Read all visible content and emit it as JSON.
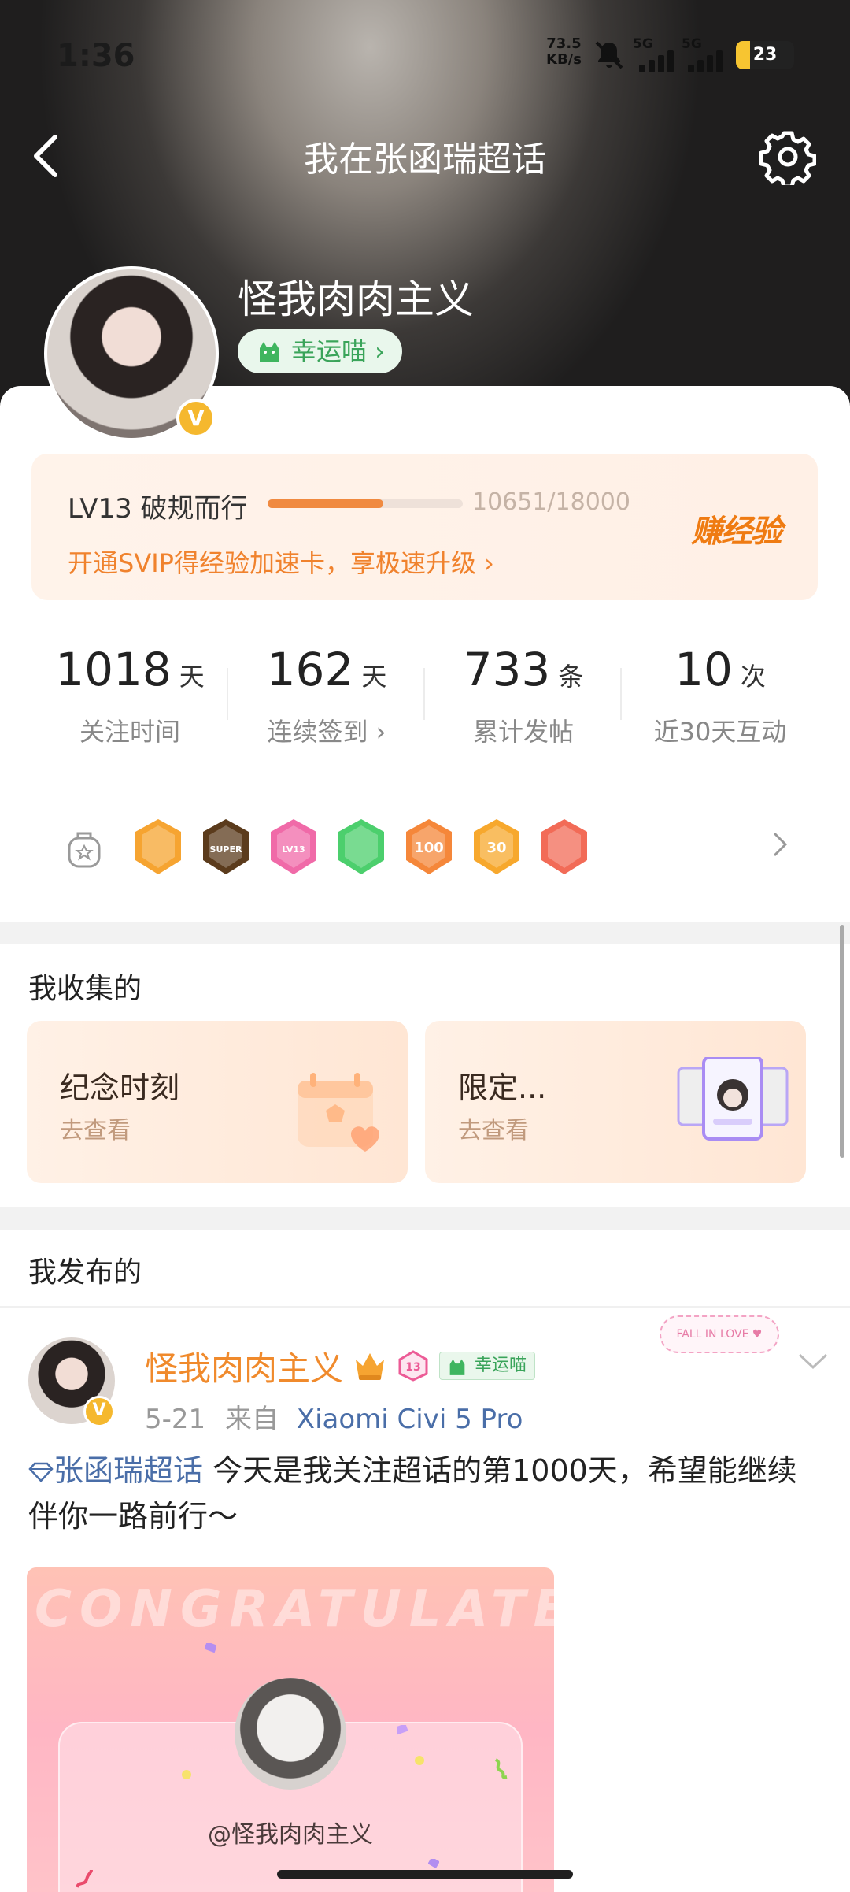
{
  "status_bar": {
    "time": "1:36",
    "net_speed_value": "73.5",
    "net_speed_unit": "KB/s",
    "sim1": "5G",
    "sim2": "5G",
    "battery": "23"
  },
  "header": {
    "title": "我在张函瑞超话",
    "back_icon": "chevron-left-icon",
    "settings_icon": "gear-icon"
  },
  "profile": {
    "username": "怪我肉肉主义",
    "lucky_badge": "幸运喵 ›",
    "verified_badge": "V"
  },
  "level": {
    "label": "LV13 破规而行",
    "exp_text": "10651/18000",
    "exp_current": 10651,
    "exp_total": 18000,
    "svip_promo": "开通SVIP得经验加速卡，享极速升级 ›",
    "earn_button": "赚经验"
  },
  "stats": [
    {
      "value": "1018",
      "unit": "天",
      "label": "关注时间"
    },
    {
      "value": "162",
      "unit": "天",
      "label": "连续签到 ›"
    },
    {
      "value": "733",
      "unit": "条",
      "label": "累计发帖"
    },
    {
      "value": "10",
      "unit": "次",
      "label": "近30天互动"
    }
  ],
  "badges": {
    "items": [
      {
        "icon": "crown-badge-icon",
        "color": "#f6a431",
        "text": ""
      },
      {
        "icon": "super-badge-icon",
        "color": "#5b3b1c",
        "text": "SUPER"
      },
      {
        "icon": "lv13-badge-icon",
        "color": "#f06aa8",
        "text": "LV13"
      },
      {
        "icon": "hand-badge-icon",
        "color": "#4ccf6d",
        "text": ""
      },
      {
        "icon": "100-days-badge-icon",
        "color": "#f5873a",
        "text": "100"
      },
      {
        "icon": "30-days-badge-icon",
        "color": "#f7a82d",
        "text": "30"
      },
      {
        "icon": "heart-hand-badge-icon",
        "color": "#f26b57",
        "text": ""
      }
    ]
  },
  "collections": {
    "title": "我收集的",
    "items": [
      {
        "title": "纪念时刻",
        "action": "去查看"
      },
      {
        "title": "限定...",
        "action": "去查看"
      }
    ]
  },
  "posts": {
    "title": "我发布的",
    "items": [
      {
        "author": "怪我肉肉主义",
        "lucky_tag": "幸运喵",
        "level_tag": "13",
        "decoration": "FALL IN LOVE",
        "date": "5-21",
        "source_prefix": "来自",
        "device": "Xiaomi Civi 5 Pro",
        "topic": "张函瑞超话",
        "text": " 今天是我关注超话的第1000天，希望能继续伴你一路前行～",
        "image_watermark": "CONGRATULATE",
        "image_caption": "@怪我肉肉主义"
      }
    ]
  }
}
